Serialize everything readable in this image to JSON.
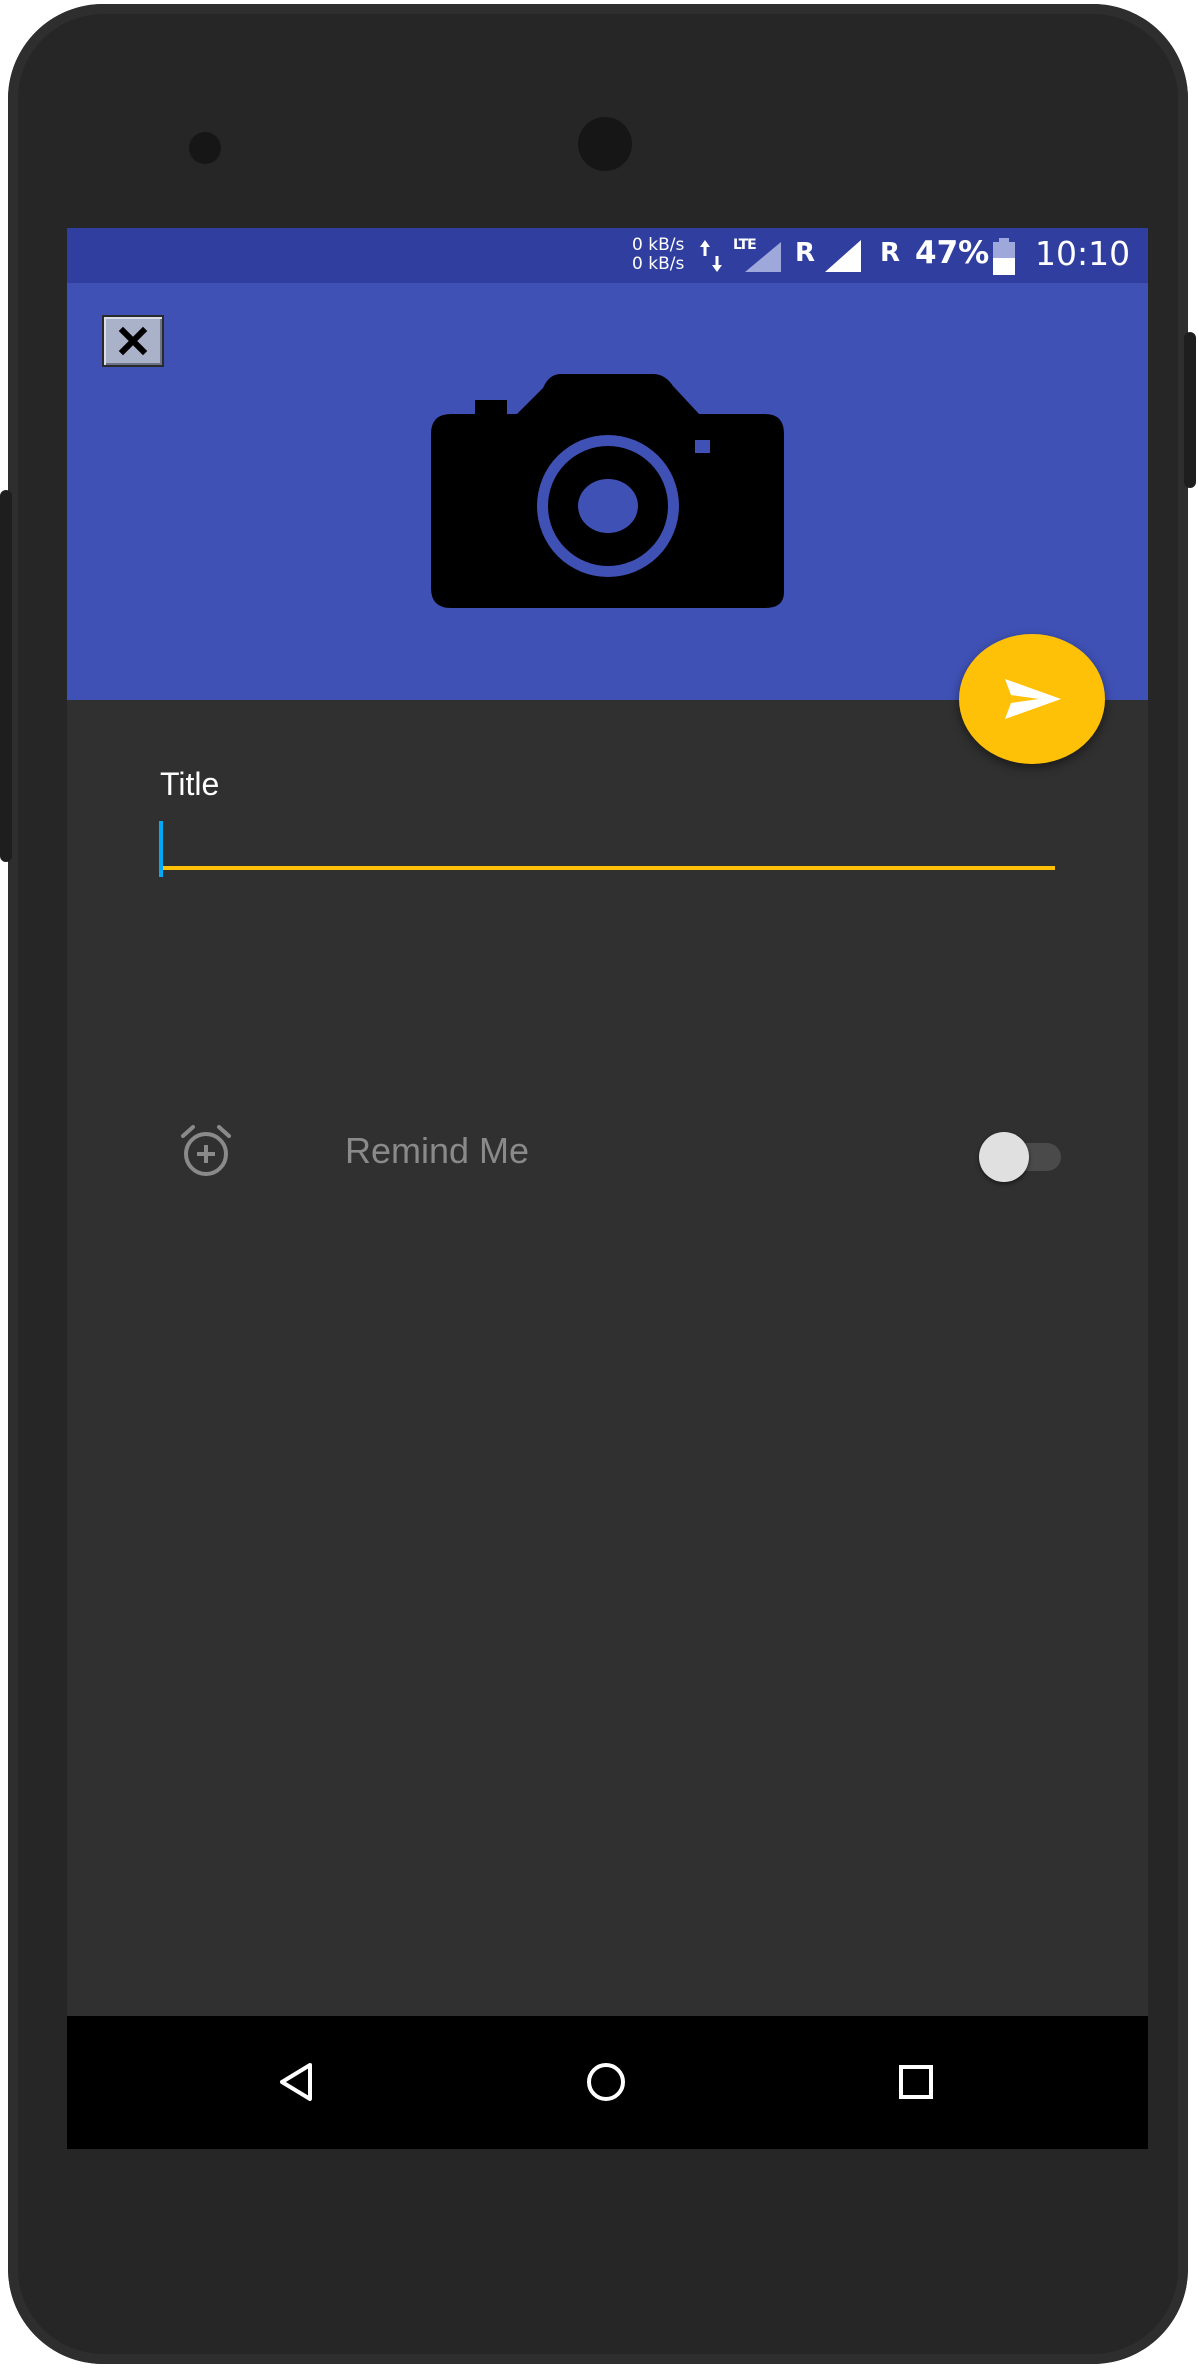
{
  "status_bar": {
    "net_up": "0 kB/s",
    "net_down": "0 kB/s",
    "network_type": "LTE",
    "roaming_1": "R",
    "roaming_2": "R",
    "battery_percent": "47%",
    "time": "10:10"
  },
  "header": {
    "close_icon": "close-icon",
    "image_placeholder_icon": "camera-icon",
    "background_color": "#3f51b5",
    "status_color": "#303f9f"
  },
  "fab": {
    "icon": "send-icon",
    "color": "#ffc107"
  },
  "form": {
    "title_label": "Title",
    "title_value": "",
    "accent_color": "#ffc107",
    "caret_color": "#03a9f4"
  },
  "reminder": {
    "icon": "alarm-add-icon",
    "label": "Remind Me",
    "enabled": false
  },
  "nav_bar": {
    "back_icon": "back-icon",
    "home_icon": "home-icon",
    "recents_icon": "recents-icon"
  }
}
